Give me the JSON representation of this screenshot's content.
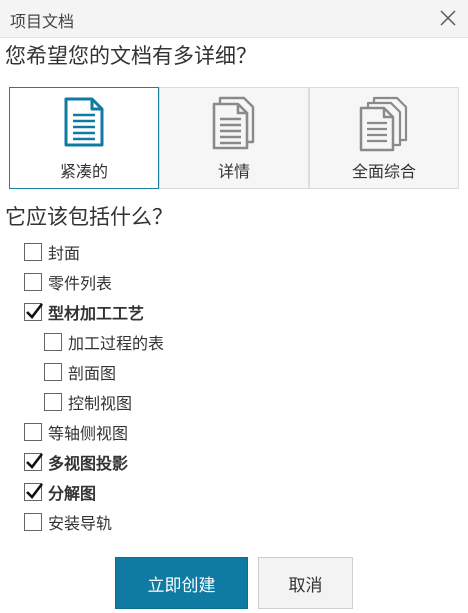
{
  "dialog": {
    "title": "项目文档"
  },
  "detail_question": "您希望您的文档有多详细？",
  "detail_options": [
    {
      "label": "紧凑的",
      "icon": "single-document-icon",
      "selected": true
    },
    {
      "label": "详情",
      "icon": "double-document-icon",
      "selected": false
    },
    {
      "label": "全面综合",
      "icon": "document-stack-icon",
      "selected": false
    }
  ],
  "include_question": "它应该包括什么？",
  "include_options": [
    {
      "label": "封面",
      "checked": false
    },
    {
      "label": "零件列表",
      "checked": false
    },
    {
      "label": "型材加工工艺",
      "checked": true
    },
    {
      "label": "加工过程的表",
      "checked": false
    },
    {
      "label": "剖面图",
      "checked": false
    },
    {
      "label": "控制视图",
      "checked": false
    },
    {
      "label": "等轴侧视图",
      "checked": false
    },
    {
      "label": "多视图投影",
      "checked": true
    },
    {
      "label": "分解图",
      "checked": true
    },
    {
      "label": "安装导轨",
      "checked": false
    }
  ],
  "buttons": {
    "create": "立即创建",
    "cancel": "取消"
  },
  "colors": {
    "accent": "#107ba2",
    "selected_border": "#1a7ea2",
    "icon_gray": "#8a8a8a"
  }
}
